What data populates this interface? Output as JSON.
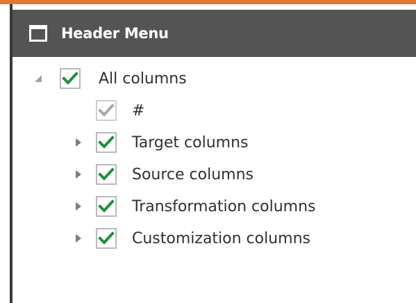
{
  "header": {
    "title": "Header Menu",
    "icon": "window-icon"
  },
  "tree": {
    "root": {
      "label": "All columns",
      "expanded": true,
      "checked": true
    },
    "children": [
      {
        "label": "#",
        "checked": true,
        "disabled": true,
        "has_children": false
      },
      {
        "label": "Target columns",
        "checked": true,
        "has_children": true
      },
      {
        "label": "Source columns",
        "checked": true,
        "has_children": true
      },
      {
        "label": "Transformation columns",
        "checked": true,
        "has_children": true
      },
      {
        "label": "Customization columns",
        "checked": true,
        "has_children": true
      }
    ]
  },
  "colors": {
    "accent": "#e8732a",
    "header_bg": "#545454",
    "check_green": "#1e8f3a",
    "check_disabled": "#a8a8a8"
  }
}
